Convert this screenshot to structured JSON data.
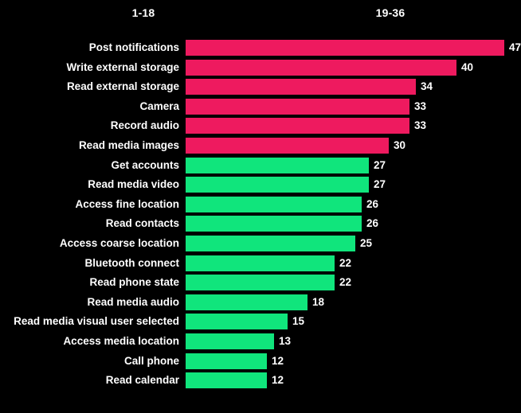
{
  "chart_data": {
    "type": "bar",
    "orientation": "horizontal",
    "title": "",
    "subtitle": "",
    "xlabel": "",
    "ylabel": "",
    "grid": false,
    "legend_position": "top",
    "xlim": [
      0,
      47
    ],
    "background_color": "#000000",
    "text_color": "#ffffff",
    "group_headers": [
      "1-18",
      "19-36"
    ],
    "series": [
      {
        "name": "1-18",
        "color": "#EE1A5F",
        "categories": [
          "Post notifications",
          "Write external storage",
          "Read external storage",
          "Camera",
          "Record audio",
          "Read media images"
        ],
        "values": [
          47,
          40,
          34,
          33,
          33,
          30
        ]
      },
      {
        "name": "19-36",
        "color": "#10E57C",
        "categories": [
          "Get accounts",
          "Read media video",
          "Access fine location",
          "Read contacts",
          "Access coarse location",
          "Bluetooth connect",
          "Read phone state",
          "Read media audio",
          "Read media visual user selected",
          "Access media location",
          "Call phone",
          "Read calendar"
        ],
        "values": [
          27,
          27,
          26,
          26,
          25,
          22,
          22,
          18,
          15,
          13,
          12,
          12
        ]
      }
    ],
    "categories": [
      "Post notifications",
      "Write external storage",
      "Read external storage",
      "Camera",
      "Record audio",
      "Read media images",
      "Get accounts",
      "Read media video",
      "Access fine location",
      "Read contacts",
      "Access coarse location",
      "Bluetooth connect",
      "Read phone state",
      "Read media audio",
      "Read media visual user selected",
      "Access media location",
      "Call phone",
      "Read calendar"
    ],
    "values": [
      47,
      40,
      34,
      33,
      33,
      30,
      27,
      27,
      26,
      26,
      25,
      22,
      22,
      18,
      15,
      13,
      12,
      12
    ],
    "bar_colors": [
      "#EE1A5F",
      "#EE1A5F",
      "#EE1A5F",
      "#EE1A5F",
      "#EE1A5F",
      "#EE1A5F",
      "#10E57C",
      "#10E57C",
      "#10E57C",
      "#10E57C",
      "#10E57C",
      "#10E57C",
      "#10E57C",
      "#10E57C",
      "#10E57C",
      "#10E57C",
      "#10E57C",
      "#10E57C"
    ],
    "value_labels": [
      "47",
      "40",
      "34",
      "33",
      "33",
      "30",
      "27",
      "27",
      "26",
      "26",
      "25",
      "22",
      "22",
      "18",
      "15",
      "13",
      "12",
      "12"
    ]
  }
}
